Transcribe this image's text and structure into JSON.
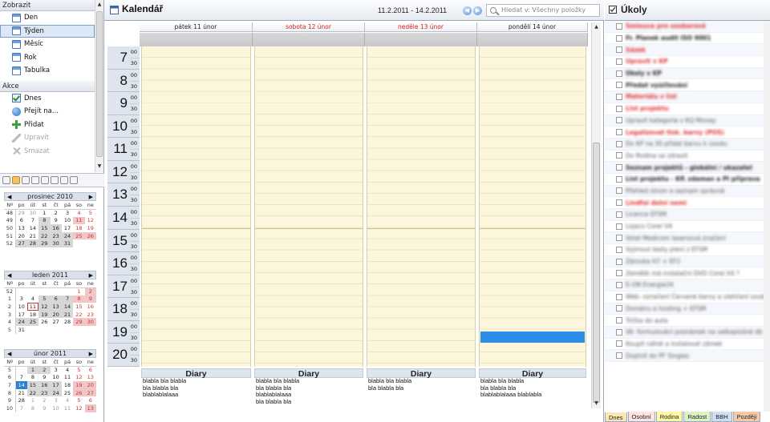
{
  "nav": {
    "section_view": "Zobrazit",
    "view_items": [
      {
        "label": "Den",
        "icon": "day-calendar-icon"
      },
      {
        "label": "Týden",
        "icon": "week-calendar-icon",
        "selected": true
      },
      {
        "label": "Měsíc",
        "icon": "month-calendar-icon"
      },
      {
        "label": "Rok",
        "icon": "year-calendar-icon"
      },
      {
        "label": "Tabulka",
        "icon": "table-icon"
      }
    ],
    "section_actions": "Akce",
    "action_items": [
      {
        "label": "Dnes",
        "icon": "check-icon",
        "enabled": true
      },
      {
        "label": "Přejít na...",
        "icon": "globe-icon",
        "enabled": true
      },
      {
        "label": "Přidat",
        "icon": "plus-icon",
        "enabled": true
      },
      {
        "label": "Upravit",
        "icon": "pencil-icon",
        "enabled": false
      },
      {
        "label": "Smazat",
        "icon": "delete-icon",
        "enabled": false
      }
    ]
  },
  "minicals": [
    {
      "month": "prosinec",
      "year": "2010",
      "dow": [
        "Nº",
        "po",
        "út",
        "st",
        "čt",
        "pá",
        "so",
        "ne"
      ],
      "weeks": [
        [
          "48",
          "29",
          "30",
          "1",
          "2",
          "3",
          "4",
          "5"
        ],
        [
          "49",
          "6",
          "7",
          "8",
          "9",
          "10",
          "11",
          "12"
        ],
        [
          "50",
          "13",
          "14",
          "15",
          "16",
          "17",
          "18",
          "19"
        ],
        [
          "51",
          "20",
          "21",
          "22",
          "23",
          "24",
          "25",
          "26"
        ],
        [
          "52",
          "27",
          "28",
          "29",
          "30",
          "31",
          "",
          ""
        ]
      ]
    },
    {
      "month": "leden",
      "year": "2011",
      "dow": [
        "Nº",
        "po",
        "út",
        "st",
        "čt",
        "pá",
        "so",
        "ne"
      ],
      "weeks": [
        [
          "52",
          "",
          "",
          "",
          "",
          "",
          "1",
          "2"
        ],
        [
          "1",
          "3",
          "4",
          "5",
          "6",
          "7",
          "8",
          "9"
        ],
        [
          "2",
          "10",
          "11",
          "12",
          "13",
          "14",
          "15",
          "16"
        ],
        [
          "3",
          "17",
          "18",
          "19",
          "20",
          "21",
          "22",
          "23"
        ],
        [
          "4",
          "24",
          "25",
          "26",
          "27",
          "28",
          "29",
          "30"
        ],
        [
          "5",
          "31",
          "",
          "",
          "",
          "",
          "",
          ""
        ]
      ]
    },
    {
      "month": "únor",
      "year": "2011",
      "dow": [
        "Nº",
        "po",
        "út",
        "st",
        "čt",
        "pá",
        "so",
        "ne"
      ],
      "weeks": [
        [
          "5",
          "",
          "1",
          "2",
          "3",
          "4",
          "5",
          "6"
        ],
        [
          "6",
          "7",
          "8",
          "9",
          "10",
          "11",
          "12",
          "13"
        ],
        [
          "7",
          "14",
          "15",
          "16",
          "17",
          "18",
          "19",
          "20"
        ],
        [
          "8",
          "21",
          "22",
          "23",
          "24",
          "25",
          "26",
          "27"
        ],
        [
          "9",
          "28",
          "1",
          "2",
          "3",
          "4",
          "5",
          "6"
        ],
        [
          "10",
          "7",
          "8",
          "9",
          "10",
          "11",
          "12",
          "13"
        ]
      ]
    }
  ],
  "calendar": {
    "title": "Kalendář",
    "date_range": "11.2.2011 - 14.2.2011",
    "search_placeholder": "Hledat v: Všechny položky",
    "days": [
      {
        "label": "pátek 11 únor",
        "weekend": false
      },
      {
        "label": "sobota 12 únor",
        "weekend": true
      },
      {
        "label": "neděle 13 únor",
        "weekend": true
      },
      {
        "label": "pondělí 14 únor",
        "weekend": false
      }
    ],
    "hours": [
      "7",
      "8",
      "9",
      "10",
      "11",
      "12",
      "13",
      "14",
      "15",
      "16",
      "17",
      "18",
      "19",
      "20"
    ],
    "minute_00": "00",
    "minute_30": "30",
    "diary_title": "Diary",
    "diary_entries": [
      [
        "blabla bla blabla",
        "bla blabla bla",
        "blablablalaaa"
      ],
      [
        "blabla bla blabla",
        "bla blabla bla",
        "blablablalaaa",
        "bla blabla bla"
      ],
      [
        "blabla bla blabla",
        "bla blabla bla"
      ],
      [
        "blabla bla blabla",
        "bla blabla bla",
        "blablablalaaa  blablabla"
      ]
    ],
    "event_color": "#2e8de6"
  },
  "tasks": {
    "title": "Úkoly",
    "items": [
      {
        "text": "Smlouva pro souborové",
        "style": "red"
      },
      {
        "text": "Fr. Planek audit ISO 9001",
        "style": "b"
      },
      {
        "text": "Sázek",
        "style": "red"
      },
      {
        "text": "Upravit v KP",
        "style": "red"
      },
      {
        "text": "Úkoly v KP",
        "style": "b"
      },
      {
        "text": "Předat vyúčtování",
        "style": "b"
      },
      {
        "text": "Materiálu v list",
        "style": "red"
      },
      {
        "text": "List projektu",
        "style": "red"
      },
      {
        "text": "Upravit kategorie v KQ Money",
        "style": ""
      },
      {
        "text": "Legalizovat tisk. barvy (POS)",
        "style": "red"
      },
      {
        "text": "Do KP na 30 přidat barvu k úvodu",
        "style": ""
      },
      {
        "text": "Do Rodina se zdravit",
        "style": ""
      },
      {
        "text": "Seznam projektů - globální / ukazatel",
        "style": "b"
      },
      {
        "text": "List projektu - KP, zdaman a PI příprava",
        "style": "b"
      },
      {
        "text": "Přehled strom a seznam správně",
        "style": ""
      },
      {
        "text": "Lindfal dolní nemí",
        "style": "red"
      },
      {
        "text": "Licence EFSM",
        "style": ""
      },
      {
        "text": "Lojaco Corel V4",
        "style": ""
      },
      {
        "text": "Volat Medicom lasersová značení",
        "style": ""
      },
      {
        "text": "Vyjmout texty plení z EFSM",
        "style": ""
      },
      {
        "text": "Žárovka H7 + EF2",
        "style": ""
      },
      {
        "text": "Zeměšk má instalační DVD Corel X4 ?",
        "style": ""
      },
      {
        "text": "E-ON Energie24",
        "style": ""
      },
      {
        "text": "Web: označení Červené barvy a ulehčení souborů + EF",
        "style": ""
      },
      {
        "text": "Doménu a hosting + EFSM",
        "style": ""
      },
      {
        "text": "Trička do auta",
        "style": ""
      },
      {
        "text": "Vě: formulování poznámek na velkoplošné db",
        "style": ""
      },
      {
        "text": "Koupit náhdi a instalovat zámek",
        "style": ""
      },
      {
        "text": "Doplnit do PF Singles",
        "style": ""
      }
    ],
    "tabs": [
      {
        "label": "Dnes",
        "color": "#fbe7b2"
      },
      {
        "label": "Osobní",
        "color": "#fde3e3"
      },
      {
        "label": "Rodina",
        "color": "#fff7a3"
      },
      {
        "label": "Radost",
        "color": "#d9f2c7"
      },
      {
        "label": "BBH",
        "color": "#cfe0f4"
      },
      {
        "label": "Později",
        "color": "#f4c9a7"
      }
    ]
  }
}
